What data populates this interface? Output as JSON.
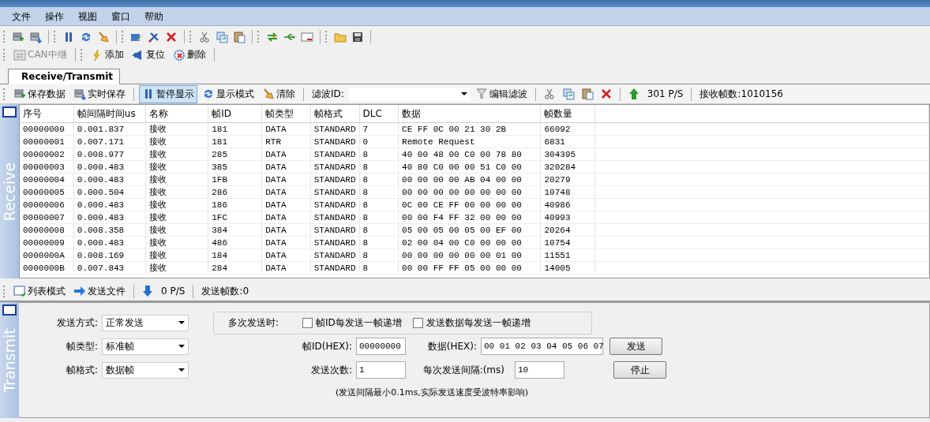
{
  "menu": [
    "文件",
    "操作",
    "视图",
    "窗口",
    "帮助"
  ],
  "toolbar2": [
    {
      "kind": "disabled",
      "label": "CAN中继"
    },
    {
      "kind": "separator"
    },
    {
      "kind": "button",
      "label": "添加"
    },
    {
      "kind": "button",
      "label": "复位"
    },
    {
      "kind": "button",
      "label": "删除"
    }
  ],
  "tabs": [
    {
      "label": "Receive/Transmit",
      "selected": true
    }
  ],
  "receive_toolbar": [
    {
      "kind": "button",
      "label": "保存数据",
      "pressed": false
    },
    {
      "kind": "button",
      "label": "实时保存",
      "pressed": false
    },
    {
      "kind": "separator"
    },
    {
      "kind": "button",
      "label": "暂停显示",
      "pressed": true
    },
    {
      "kind": "button",
      "label": "显示模式",
      "pressed": false
    },
    {
      "kind": "button",
      "label": "清除",
      "pressed": false
    },
    {
      "kind": "separator"
    },
    {
      "kind": "filter",
      "label": "滤波ID:"
    },
    {
      "kind": "button",
      "label": "编辑滤波",
      "pressed": false
    },
    {
      "kind": "separator"
    },
    {
      "kind": "icons"
    },
    {
      "kind": "separator"
    },
    {
      "kind": "up"
    },
    {
      "kind": "text",
      "label": "301 P/S"
    },
    {
      "kind": "separator"
    },
    {
      "kind": "text",
      "label": "接收帧数:1010156"
    }
  ],
  "receive_side": "Receive",
  "table": {
    "columns": [
      "序号",
      "帧间隔时间us",
      "名称",
      "帧ID",
      "帧类型",
      "帧格式",
      "DLC",
      "数据",
      "帧数量"
    ],
    "rows": [
      [
        "00000000",
        "0.001.837",
        "接收",
        "181",
        "DATA",
        "STANDARD",
        "7",
        "CE FF 0C 00 21 30 2B",
        "66092"
      ],
      [
        "00000001",
        "0.007.171",
        "接收",
        "181",
        "RTR",
        "STANDARD",
        "0",
        "Remote Request",
        "6831"
      ],
      [
        "00000002",
        "0.008.977",
        "接收",
        "285",
        "DATA",
        "STANDARD",
        "8",
        "40 00 48 00 C0 00 78 80",
        "304395"
      ],
      [
        "00000003",
        "0.000.483",
        "接收",
        "385",
        "DATA",
        "STANDARD",
        "8",
        "40 80 C0 00 00 51 C0 00",
        "320284"
      ],
      [
        "00000004",
        "0.000.483",
        "接收",
        "1FB",
        "DATA",
        "STANDARD",
        "8",
        "00 00 00 00 AB 04 00 00",
        "20279"
      ],
      [
        "00000005",
        "0.000.504",
        "接收",
        "286",
        "DATA",
        "STANDARD",
        "8",
        "00 00 00 00 00 00 00 00",
        "10748"
      ],
      [
        "00000006",
        "0.000.483",
        "接收",
        "186",
        "DATA",
        "STANDARD",
        "8",
        "0C 00 CE FF 00 00 00 00",
        "40986"
      ],
      [
        "00000007",
        "0.000.483",
        "接收",
        "1FC",
        "DATA",
        "STANDARD",
        "8",
        "00 00 F4 FF 32 00 00 00",
        "40993"
      ],
      [
        "00000008",
        "0.008.358",
        "接收",
        "384",
        "DATA",
        "STANDARD",
        "8",
        "05 00 05 00 05 00 EF 00",
        "20264"
      ],
      [
        "00000009",
        "0.000.483",
        "接收",
        "486",
        "DATA",
        "STANDARD",
        "8",
        "02 00 04 00 C0 00 00 00",
        "10754"
      ],
      [
        "0000000A",
        "0.008.169",
        "接收",
        "184",
        "DATA",
        "STANDARD",
        "8",
        "00 00 00 00 00 00 01 00",
        "11551"
      ],
      [
        "0000000B",
        "0.007.843",
        "接收",
        "284",
        "DATA",
        "STANDARD",
        "8",
        "00 00 FF FF 05 00 00 00",
        "14005"
      ]
    ]
  },
  "send_toolbar": [
    {
      "kind": "button",
      "label": "列表模式"
    },
    {
      "kind": "button",
      "label": "发送文件"
    },
    {
      "kind": "separator"
    },
    {
      "kind": "down"
    },
    {
      "kind": "text",
      "label": "0 P/S"
    },
    {
      "kind": "separator"
    },
    {
      "kind": "text",
      "label": "发送帧数:0"
    }
  ],
  "transmit_side": "Transmit",
  "transmit": {
    "send_mode": {
      "label": "发送方式:",
      "value": "正常发送"
    },
    "multi": {
      "label": "多次发送时:",
      "options": [
        {
          "label": "帧ID每发送一帧递增",
          "checked": false
        },
        {
          "label": "发送数据每发送一帧递增",
          "checked": false
        }
      ]
    },
    "frame_type": {
      "label": "帧类型:",
      "value": "标准帧"
    },
    "frame_id": {
      "label": "帧ID(HEX):",
      "value": "00000000"
    },
    "data": {
      "label": "数据(HEX):",
      "value": "00 01 02 03 04 05 06 07"
    },
    "send_button": "发送",
    "frame_format": {
      "label": "帧格式:",
      "value": "数据帧"
    },
    "send_count": {
      "label": "发送次数:",
      "value": "1"
    },
    "interval": {
      "label": "每次发送间隔:(ms)",
      "value": "10"
    },
    "stop_button": "停止",
    "note": "(发送间隔最小0.1ms,实际发送速度受波特率影响)"
  }
}
